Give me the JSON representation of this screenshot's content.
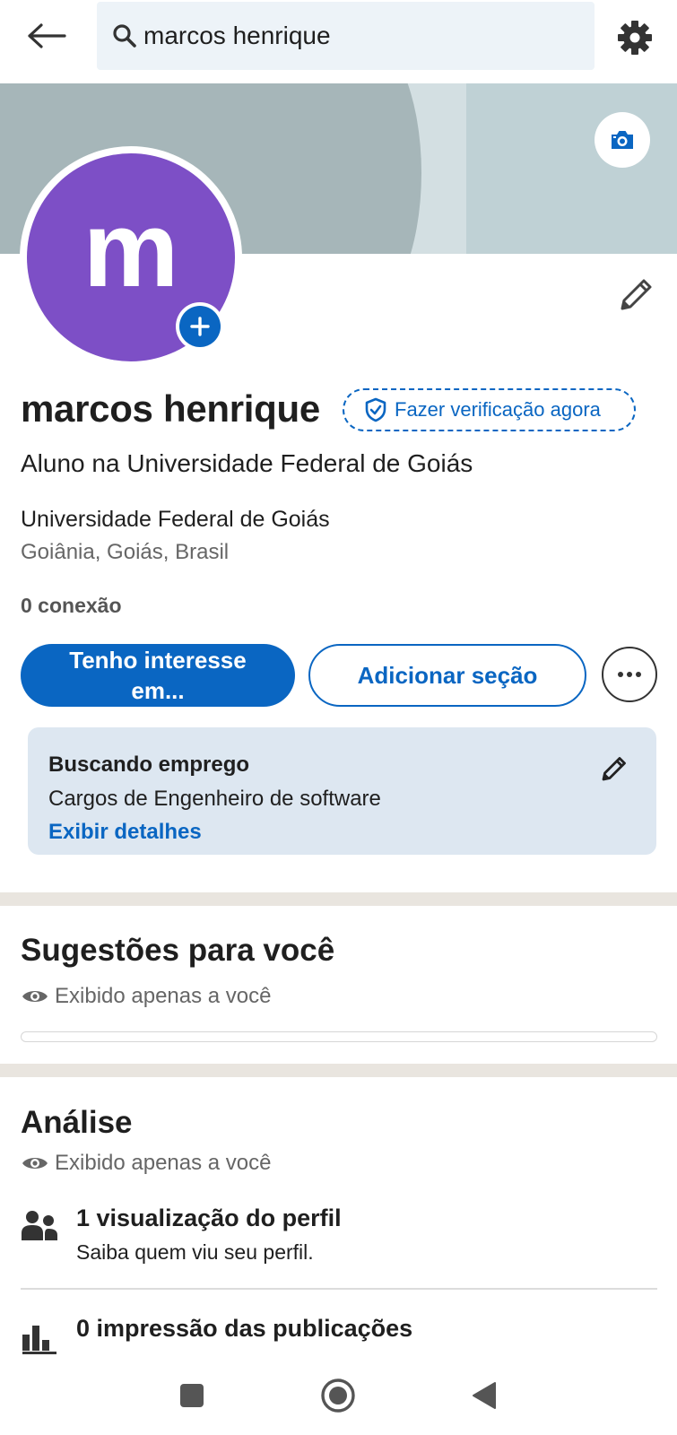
{
  "search": {
    "query": "marcos henrique"
  },
  "profile": {
    "avatar_letter": "m",
    "name": "marcos henrique",
    "verify_label": "Fazer verificação agora",
    "headline": "Aluno na Universidade Federal de Goiás",
    "organization": "Universidade Federal de Goiás",
    "location": "Goiânia, Goiás, Brasil",
    "connections": "0 conexão"
  },
  "actions": {
    "primary_label": "Tenho interesse em...",
    "secondary_label": "Adicionar seção",
    "more_icon": "ellipsis-icon"
  },
  "open_to_work": {
    "title": "Buscando emprego",
    "subtitle": "Cargos de Engenheiro de software",
    "link": "Exibir detalhes"
  },
  "suggestions": {
    "title": "Sugestões para você",
    "visibility": "Exibido apenas a você",
    "progress": 0
  },
  "analytics": {
    "title": "Análise",
    "visibility": "Exibido apenas a você",
    "metrics": [
      {
        "icon": "people-icon",
        "title": "1 visualização do perfil",
        "subtitle": "Saiba quem viu seu perfil."
      },
      {
        "icon": "bar-chart-icon",
        "title": "0 impressão das publicações",
        "subtitle": ""
      }
    ]
  },
  "colors": {
    "brand_blue": "#0a66c2",
    "avatar_purple": "#7d4fc6",
    "card_bg": "#dde7f1",
    "banner_gray": "#a6b6b9"
  }
}
